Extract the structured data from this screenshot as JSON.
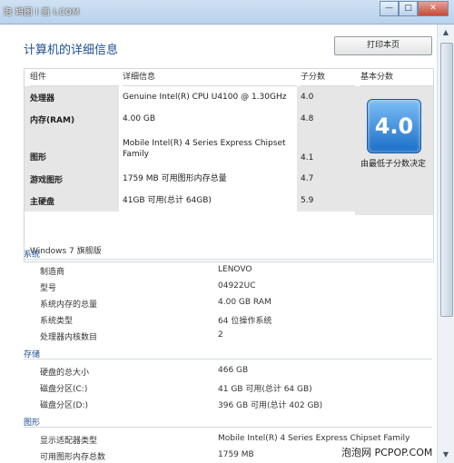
{
  "window": {
    "title": "泡 妈图 Ⅰ 画 Ⅰ",
    "min": "—",
    "max": "□",
    "close": "✕"
  },
  "heading": "计算机的详细信息",
  "print_button": "打印本页",
  "table": {
    "headers": [
      "组件",
      "详细信息",
      "子分数",
      "基本分数"
    ],
    "rows": [
      {
        "cat": "处理器",
        "detail": "Genuine Intel(R) CPU U4100 @ 1.30GHz",
        "sub": "4.0"
      },
      {
        "cat": "内存(RAM)",
        "detail": "4.00 GB",
        "sub": "4.8"
      },
      {
        "cat": "图形",
        "detail": "Mobile Intel(R) 4 Series Express Chipset Family",
        "sub": "4.1"
      },
      {
        "cat": "游戏图形",
        "detail": "1759 MB 可用图形内存总量",
        "sub": "4.7"
      },
      {
        "cat": "主硬盘",
        "detail": "41GB 可用(总计 64GB)",
        "sub": "5.9"
      }
    ],
    "base_score": "4.0",
    "base_note": "由最低子分数决定"
  },
  "windows_version": "Windows 7 旗舰版",
  "sections": [
    {
      "title": "系统",
      "items": [
        {
          "k": "制造商",
          "v": "LENOVO"
        },
        {
          "k": "型号",
          "v": "04922UC"
        },
        {
          "k": "系统内存的总量",
          "v": "4.00 GB RAM"
        },
        {
          "k": "系统类型",
          "v": "64 位操作系统"
        },
        {
          "k": "处理器内核数目",
          "v": "2"
        }
      ]
    },
    {
      "title": "存储",
      "items": [
        {
          "k": "硬盘的总大小",
          "v": "466 GB"
        },
        {
          "k": "磁盘分区(C:)",
          "v": "41 GB 可用(总计 64 GB)"
        },
        {
          "k": "磁盘分区(D:)",
          "v": "396 GB 可用(总计 402 GB)"
        }
      ]
    },
    {
      "title": "图形",
      "items": [
        {
          "k": "显示适配器类型",
          "v": "Mobile Intel(R) 4 Series Express Chipset Family"
        },
        {
          "k": "可用图形内存总数",
          "v": "1759 MB"
        }
      ]
    }
  ],
  "watermark_top": "泡 妈图 Ⅰ 画 Ⅰ.COM",
  "watermark_bottom": "泡泡网 PCPOP.COM"
}
